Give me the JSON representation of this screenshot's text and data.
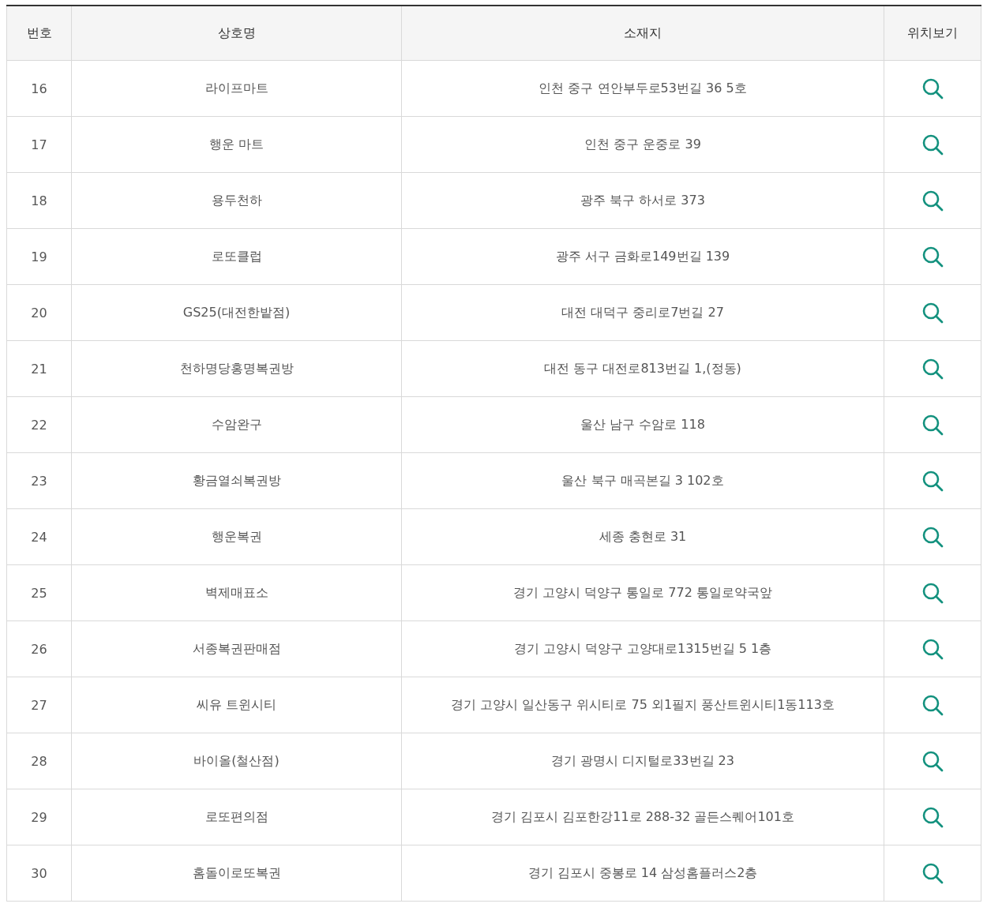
{
  "table": {
    "columns": [
      "번호",
      "상호명",
      "소재지",
      "위치보기"
    ],
    "rows": [
      {
        "number": "16",
        "name": "라이프마트",
        "address": "인천 중구 연안부두로53번길 36 5호"
      },
      {
        "number": "17",
        "name": "행운 마트",
        "address": "인천 중구 운중로 39"
      },
      {
        "number": "18",
        "name": "용두천하",
        "address": "광주 북구 하서로 373"
      },
      {
        "number": "19",
        "name": "로또클럽",
        "address": "광주 서구 금화로149번길 139"
      },
      {
        "number": "20",
        "name": "GS25(대전한밭점)",
        "address": "대전 대덕구 중리로7번길 27"
      },
      {
        "number": "21",
        "name": "천하명당홍명복권방",
        "address": "대전 동구 대전로813번길 1,(정동)"
      },
      {
        "number": "22",
        "name": "수암완구",
        "address": "울산 남구 수암로 118"
      },
      {
        "number": "23",
        "name": "황금열쇠복권방",
        "address": "울산 북구 매곡본길 3 102호"
      },
      {
        "number": "24",
        "name": "행운복권",
        "address": "세종 충현로 31"
      },
      {
        "number": "25",
        "name": "벽제매표소",
        "address": "경기 고양시 덕양구 통일로 772 통일로약국앞"
      },
      {
        "number": "26",
        "name": "서종복권판매점",
        "address": "경기 고양시 덕양구 고양대로1315번길 5 1층"
      },
      {
        "number": "27",
        "name": "씨유 트윈시티",
        "address": "경기 고양시 일산동구 위시티로 75 외1필지 풍산트윈시티1동113호"
      },
      {
        "number": "28",
        "name": "바이올(철산점)",
        "address": "경기 광명시 디지털로33번길 23"
      },
      {
        "number": "29",
        "name": "로또편의점",
        "address": "경기 김포시 김포한강11로 288-32 골든스퀘어101호"
      },
      {
        "number": "30",
        "name": "홈돌이로또복권",
        "address": "경기 김포시 중봉로 14 삼성홈플러스2층"
      }
    ]
  }
}
